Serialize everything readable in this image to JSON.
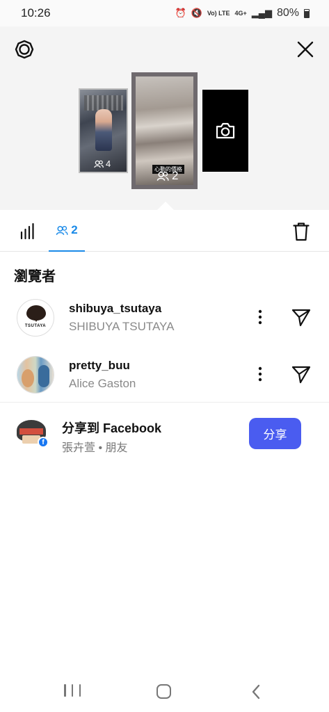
{
  "status_bar": {
    "time": "10:26",
    "network_label": "Vo) LTE",
    "signal_label": "4G+",
    "battery": "80%"
  },
  "story_preview": {
    "left_thumb_views": "4",
    "center_thumb_views": "2",
    "center_tag": "心動的價格"
  },
  "tabs": {
    "viewers_count": "2"
  },
  "viewers": {
    "title": "瀏覽者",
    "items": [
      {
        "username": "shibuya_tsutaya",
        "fullname": "SHIBUYA TSUTAYA",
        "avatar_text": "TSUTAYA"
      },
      {
        "username": "pretty_buu",
        "fullname": "Alice Gaston"
      }
    ]
  },
  "share": {
    "title": "分享到 Facebook",
    "subtitle": "張卉萱 • 朋友",
    "button_label": "分享"
  },
  "colors": {
    "accent_blue": "#1a8ae8",
    "share_button": "#4a5cf0",
    "facebook_blue": "#1877f2"
  }
}
